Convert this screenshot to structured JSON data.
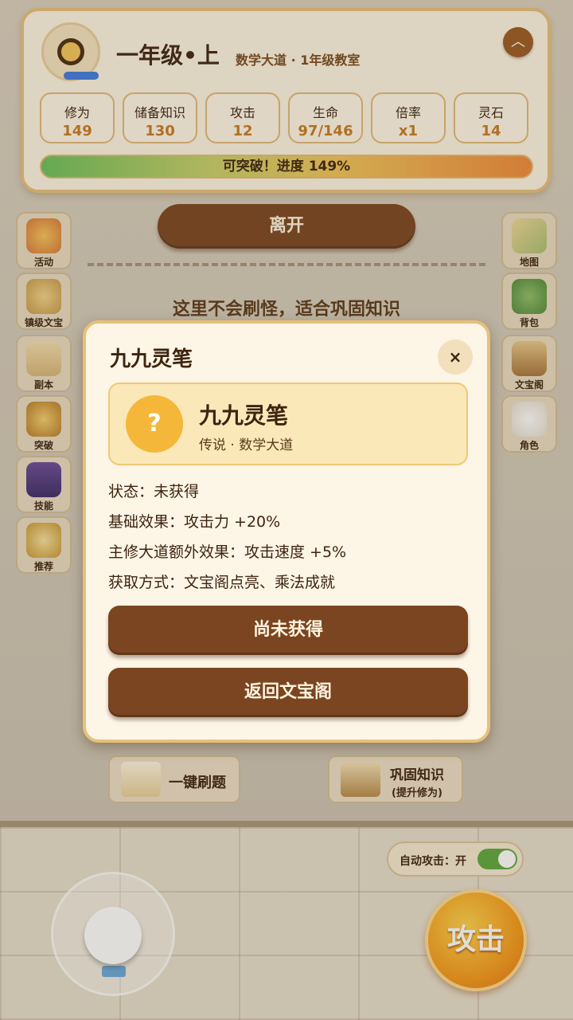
{
  "header": {
    "grade": "一年级•上",
    "location": "数学大道 · 1年级教室",
    "collapse_icon": "chevron-up-icon",
    "stats": [
      {
        "label": "修为",
        "value": "149"
      },
      {
        "label": "储备知识",
        "value": "130"
      },
      {
        "label": "攻击",
        "value": "12"
      },
      {
        "label": "生命",
        "value": "97/146"
      },
      {
        "label": "倍率",
        "value": "x1"
      },
      {
        "label": "灵石",
        "value": "14"
      }
    ],
    "progress_text": "可突破！进度 149%",
    "progress_percent": 149
  },
  "leave_label": "离开",
  "hint": "这里不会刷怪，适合巩固知识",
  "left_menu": [
    {
      "label": "活动",
      "icon": "event-icon"
    },
    {
      "label": "镇级文宝",
      "icon": "treasure-statue-icon"
    },
    {
      "label": "副本",
      "icon": "scroll-icon"
    },
    {
      "label": "突破",
      "icon": "breakthrough-icon"
    },
    {
      "label": "技能",
      "icon": "skill-book-icon"
    },
    {
      "label": "推荐",
      "icon": "globe-icon"
    }
  ],
  "right_menu": [
    {
      "label": "地图",
      "icon": "map-icon"
    },
    {
      "label": "背包",
      "icon": "backpack-icon"
    },
    {
      "label": "文宝阁",
      "icon": "treasure-book-icon"
    },
    {
      "label": "角色",
      "icon": "character-icon"
    }
  ],
  "actions": {
    "quick_practice": "一键刷题",
    "consolidate": "巩固知识",
    "consolidate_sub": "(提升修为)"
  },
  "auto_attack": {
    "label": "自动攻击：开",
    "on": true
  },
  "attack_label": "攻击",
  "modal": {
    "title": "九九灵笔",
    "close_glyph": "×",
    "item": {
      "icon_glyph": "?",
      "name": "九九灵笔",
      "subtitle": "传说 · 数学大道"
    },
    "lines": [
      "状态：未获得",
      "基础效果：攻击力 +20%",
      "主修大道额外效果：攻击速度 +5%",
      "获取方式：文宝阁点亮、乘法成就"
    ],
    "primary_button": "尚未获得",
    "secondary_button": "返回文宝阁"
  },
  "colors": {
    "brown_button": "#7a4520",
    "gold_border": "#e7c07a",
    "cream": "#fdf5e6",
    "stat_value": "#c77a1e"
  }
}
